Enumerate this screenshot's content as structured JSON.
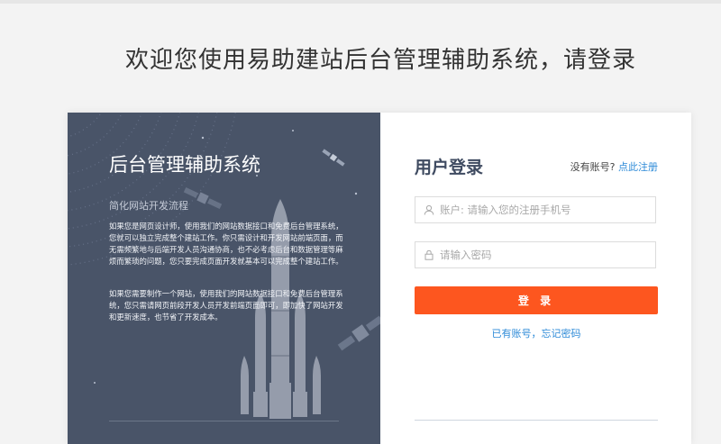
{
  "page": {
    "welcome_text": "欢迎您使用易助建站后台管理辅助系统，请登录"
  },
  "left_panel": {
    "title": "后台管理辅助系统",
    "subtitle": "简化网站开发流程",
    "paragraph1": "如果您是网页设计师，使用我们的网站数据接口和免费后台管理系统，您就可以独立完成整个建站工作。你只需设计和开发网站前端页面，而无需频繁地与后端开发人员沟通协商，也不必考虑后台和数据管理等麻烦而繁琐的问题，您只要完成页面开发就基本可以完成整个建站工作。",
    "paragraph2": "如果您需要制作一个网站，使用我们的网站数据接口和免费后台管理系统，您只需请网页前段开发人员开发前端页面即可，即加快了网站开发和更新速度，也节省了开发成本。"
  },
  "login": {
    "title": "用户登录",
    "no_account_text": "没有账号?",
    "register_link": "点此注册",
    "phone_placeholder": "账户: 请输入您的注册手机号",
    "password_placeholder": "请输入密码",
    "login_button": "登 录",
    "have_account_link": "已有账号",
    "link_separator": "，",
    "forgot_password_link": "忘记密码"
  },
  "icons": {
    "user": "user-icon",
    "lock": "lock-icon",
    "rocket": "rocket-illustration",
    "satellite": "satellite-illustration"
  },
  "colors": {
    "panel_bg": "#495468",
    "accent_orange": "#fd561f",
    "link_blue": "#2e8bd8",
    "title_navy": "#3f4b61"
  }
}
